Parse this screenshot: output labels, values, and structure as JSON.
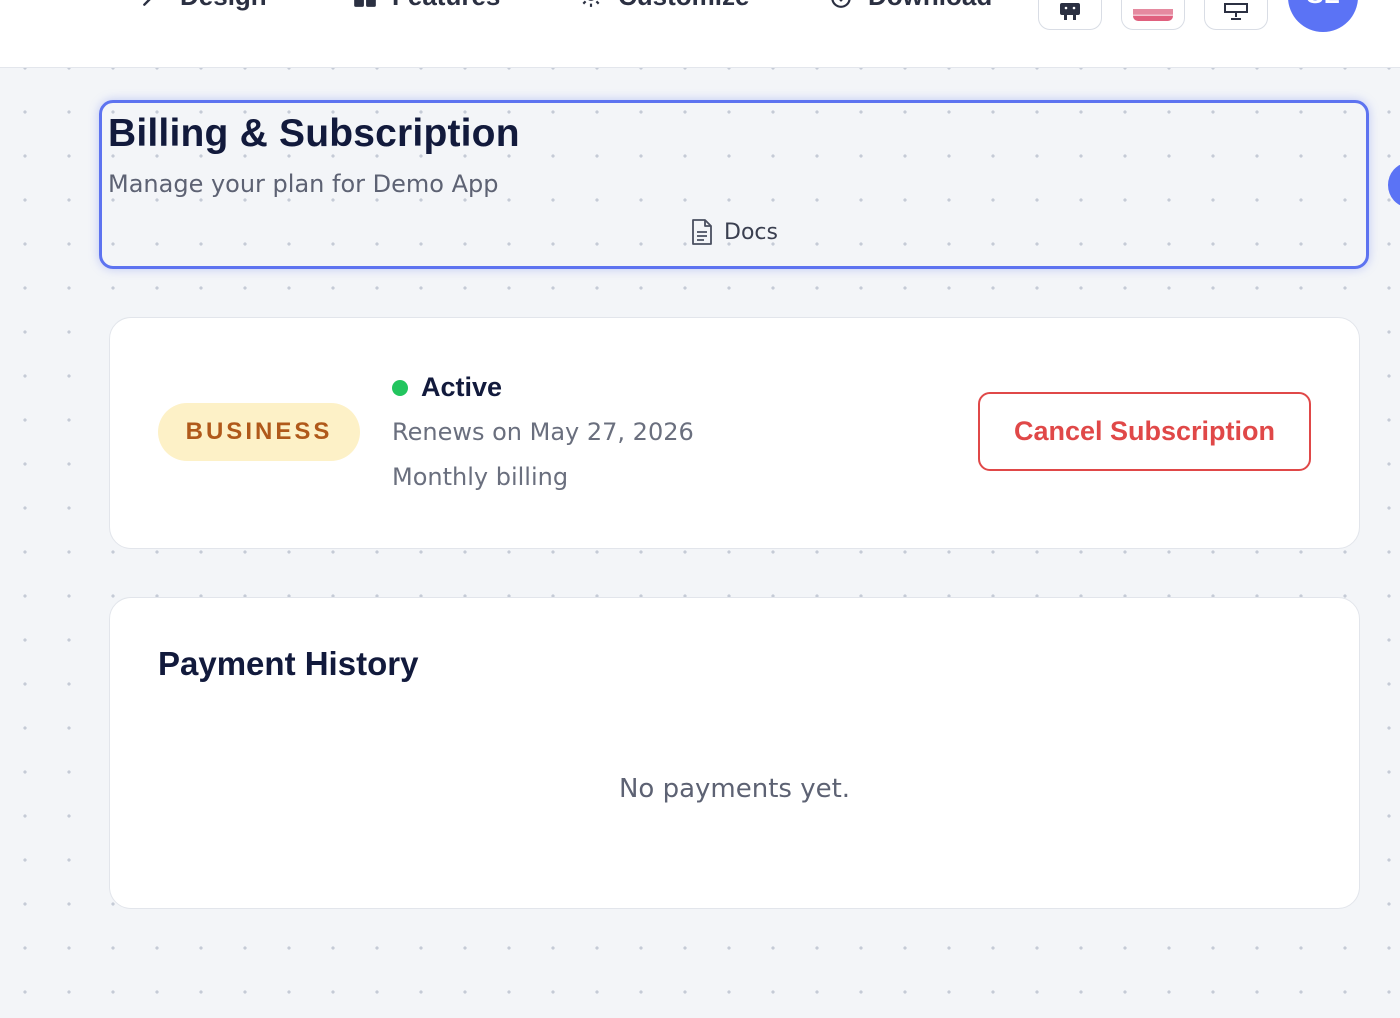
{
  "nav": {
    "items": [
      {
        "label": "Design",
        "icon": "wand-icon"
      },
      {
        "label": "Features",
        "icon": "grid-icon"
      },
      {
        "label": "Customize",
        "icon": "gear-icon"
      },
      {
        "label": "Download",
        "icon": "download-icon"
      }
    ],
    "icon_buttons": [
      "android-icon",
      "flag-icon",
      "monitor-icon"
    ],
    "avatar_initials": "SL"
  },
  "header": {
    "title": "Billing & Subscription",
    "subtitle": "Manage your plan for Demo App",
    "docs_label": "Docs"
  },
  "subscription": {
    "plan": "BUSINESS",
    "status": "Active",
    "status_color": "#22c55e",
    "renews": "Renews on May 27, 2026",
    "billing": "Monthly billing",
    "cancel_label": "Cancel Subscription"
  },
  "payment_history": {
    "title": "Payment History",
    "empty_message": "No payments yet."
  },
  "colors": {
    "accent": "#5b73f5",
    "danger": "#e04848",
    "badge_bg": "#fdf1c7",
    "badge_text": "#b0591a"
  }
}
